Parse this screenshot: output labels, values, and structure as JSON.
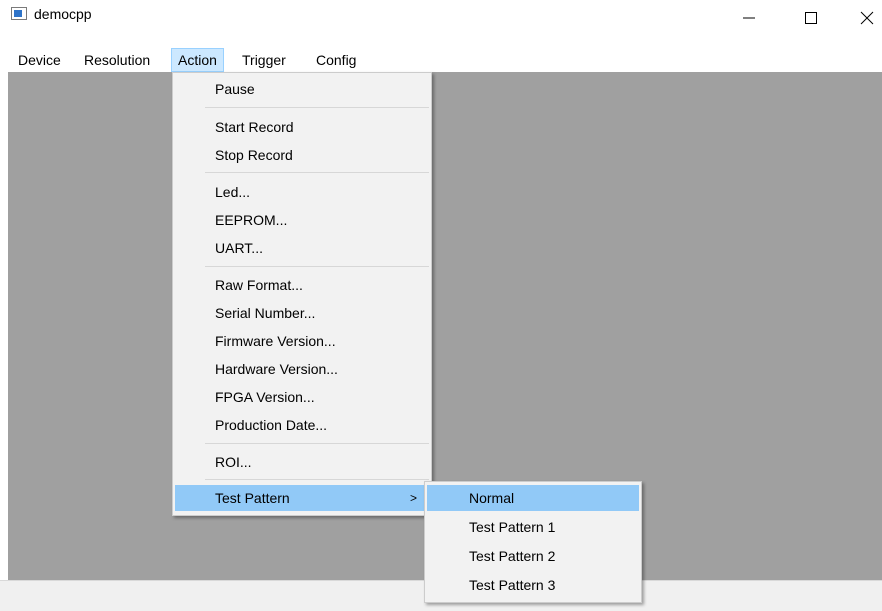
{
  "window": {
    "title": "democpp"
  },
  "menubar": {
    "items": [
      "Device",
      "Resolution",
      "Action",
      "Trigger",
      "Config"
    ]
  },
  "action_menu": {
    "pause": "Pause",
    "start_record": "Start Record",
    "stop_record": "Stop Record",
    "led": "Led...",
    "eeprom": "EEPROM...",
    "uart": "UART...",
    "raw_format": "Raw Format...",
    "serial_number": "Serial Number...",
    "firmware_version": "Firmware Version...",
    "hardware_version": "Hardware Version...",
    "fpga_version": "FPGA Version...",
    "production_date": "Production Date...",
    "roi": "ROI...",
    "test_pattern": "Test Pattern",
    "submenu_arrow": ">"
  },
  "test_pattern_menu": {
    "items": [
      "Normal",
      "Test Pattern 1",
      "Test Pattern 2",
      "Test Pattern 3"
    ],
    "selected": "Normal"
  },
  "colors": {
    "content_bg": "#a0a0a0",
    "menu_bg": "#f2f2f2",
    "highlight": "#91c9f7",
    "menubar_active": "#cce8ff"
  },
  "icons": {
    "app": "window-app-icon",
    "minimize": "minimize-icon",
    "maximize": "maximize-icon",
    "close": "close-icon"
  }
}
